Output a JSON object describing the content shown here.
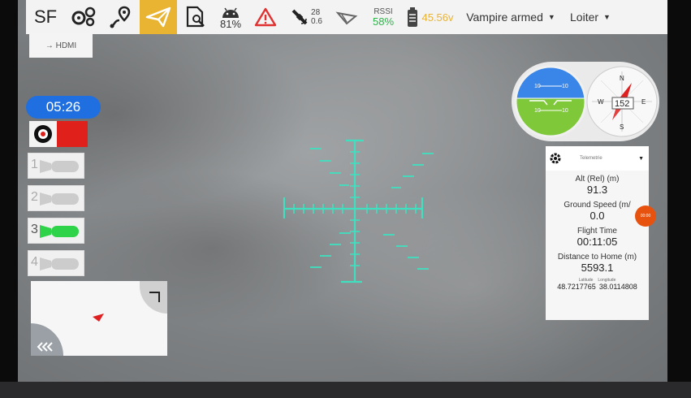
{
  "toolbar": {
    "brand": "SF",
    "battery_percent": "81%",
    "satellites": "28",
    "hdop": "0.6",
    "rssi_label": "RSSI",
    "rssi_value": "58%",
    "voltage": "45.56v",
    "vehicle_state": "Vampire armed",
    "flight_mode": "Loiter"
  },
  "video_source": "→ HDMI",
  "timer": "05:26",
  "motors": [
    {
      "label": "1",
      "state": "inactive"
    },
    {
      "label": "2",
      "state": "inactive"
    },
    {
      "label": "3",
      "state": "active"
    },
    {
      "label": "4",
      "state": "inactive"
    }
  ],
  "attitude": {
    "pitch_ticks": [
      "10",
      "10",
      "10",
      "10"
    ]
  },
  "compass": {
    "heading": "152",
    "n": "N",
    "e": "E",
    "s": "S",
    "w": "W"
  },
  "telemetry": {
    "selector": "Telemetrie",
    "alt_label": "Alt (Rel) (m)",
    "alt_value": "91.3",
    "gs_label": "Ground Speed (m/",
    "gs_value": "0.0",
    "ft_label": "Flight Time",
    "ft_value": "00:11:05",
    "dh_label": "Distance to Home (m)",
    "dh_value": "5593.1",
    "lat_label": "Latitude",
    "lon_label": "Longitude",
    "lat_value": "48.7217765",
    "lon_value": "38.0114808"
  },
  "orange_badge": "00:00",
  "colors": {
    "accent": "#e8b432",
    "timer": "#1f6fe0",
    "reticle": "#3fe0c0",
    "record": "#e0201a",
    "motor_active": "#2fd34a",
    "badge": "#e8520f"
  }
}
